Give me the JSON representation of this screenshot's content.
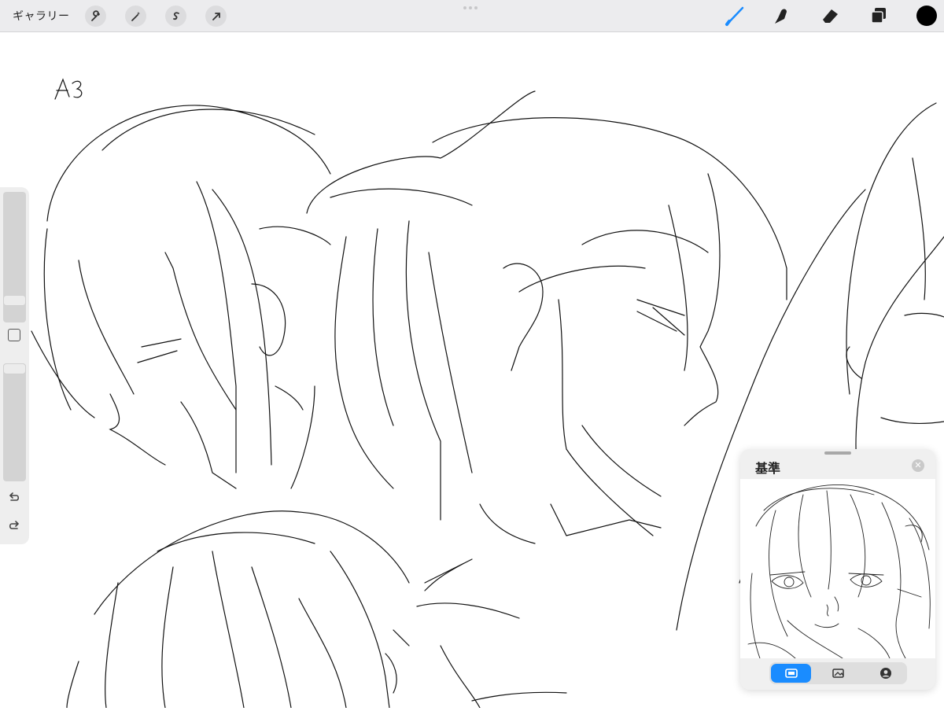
{
  "toolbar": {
    "gallery_label": "ギャラリー",
    "left_tools": [
      {
        "name": "wrench-icon",
        "label": "actions"
      },
      {
        "name": "magic-wand-icon",
        "label": "adjustments"
      },
      {
        "name": "selection-icon",
        "label": "selection"
      },
      {
        "name": "arrow-icon",
        "label": "transform"
      }
    ],
    "right_tools": [
      {
        "name": "brush-icon",
        "active": true
      },
      {
        "name": "smudge-icon",
        "active": false
      },
      {
        "name": "eraser-icon",
        "active": false
      },
      {
        "name": "layers-icon",
        "active": false
      }
    ],
    "current_color": "#000000",
    "accent_color": "#1a8cff"
  },
  "sidebar": {
    "brush_size_level": 0.3,
    "opacity_level": 0.15
  },
  "reference_panel": {
    "title": "基準",
    "close_symbol": "✕",
    "modes": [
      {
        "name": "canvas-mode-icon",
        "active": true
      },
      {
        "name": "image-mode-icon",
        "active": false
      },
      {
        "name": "face-mode-icon",
        "active": false
      }
    ]
  },
  "canvas": {
    "corner_scribble": "A3"
  }
}
